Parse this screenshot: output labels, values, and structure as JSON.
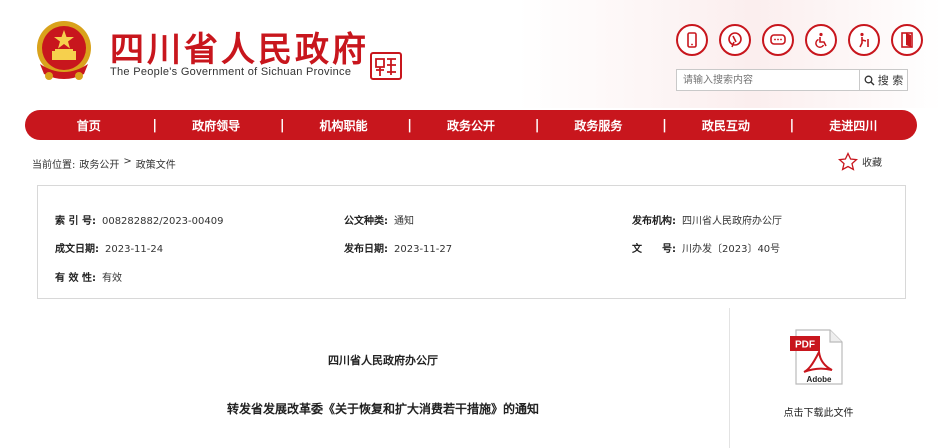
{
  "header": {
    "title": "四川省人民政府",
    "subtitle": "The People's Government of Sichuan Province",
    "seal_text": "四川\n政務",
    "icons": [
      "mobile-icon",
      "weibo-icon",
      "message-icon",
      "accessibility-icon",
      "elderly-care-icon",
      "exit-icon"
    ]
  },
  "search": {
    "placeholder": "请输入搜索内容",
    "button_label": "搜 索"
  },
  "nav": {
    "items": [
      "首页",
      "政府领导",
      "机构职能",
      "政务公开",
      "政务服务",
      "政民互动",
      "走进四川"
    ],
    "separator": "|"
  },
  "breadcrumb": {
    "prefix": "当前位置:",
    "items": [
      "政务公开",
      "政策文件"
    ],
    "separator": ">"
  },
  "favorite": {
    "label": "收藏"
  },
  "meta": {
    "index_label": "索 引 号:",
    "index_value": "008282882/2023-00409",
    "type_label": "公文种类:",
    "type_value": "通知",
    "org_label": "发布机构:",
    "org_value": "四川省人民政府办公厅",
    "created_label": "成文日期:",
    "created_value": "2023-11-24",
    "published_label": "发布日期:",
    "published_value": "2023-11-27",
    "docno_label": "文　　号:",
    "docno_value": "川办发〔2023〕40号",
    "validity_label": "有 效 性:",
    "validity_value": "有效"
  },
  "document": {
    "issuer": "四川省人民政府办公厅",
    "title": "转发省发展改革委《关于恢复和扩大消费若干措施》的通知"
  },
  "sidebar": {
    "pdf_badge": "PDF",
    "pdf_brand": "Adobe",
    "download_label": "点击下载此文件"
  },
  "colors": {
    "brand_red": "#c8161d",
    "border_gray": "#d8d8d8"
  }
}
